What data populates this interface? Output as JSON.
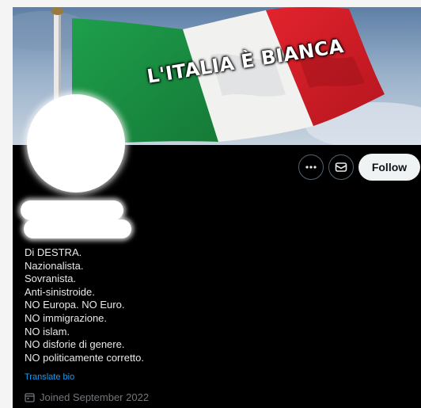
{
  "banner": {
    "text": "L'ITALIA È BIANCA"
  },
  "actions": {
    "more_icon": "ellipsis-icon",
    "message_icon": "envelope-icon",
    "follow_label": "Follow"
  },
  "bio": {
    "lines": [
      "Di DESTRA.",
      "Nazionalista.",
      "Sovranista.",
      "Anti-sinistroide.",
      "NO Europa. NO Euro.",
      "NO immigrazione.",
      "NO islam.",
      "NO disforie di genere.",
      "NO politicamente corretto."
    ],
    "translate_label": "Translate bio"
  },
  "joined": {
    "icon": "calendar-icon",
    "text": "Joined September 2022"
  },
  "colors": {
    "background": "#000000",
    "text": "#e7e9ea",
    "link": "#1d9bf0",
    "muted": "#71767b",
    "follow_bg": "#eff3f4",
    "flag_green": "#1c9a48",
    "flag_white": "#f3f3f3",
    "flag_red": "#d8202a"
  }
}
